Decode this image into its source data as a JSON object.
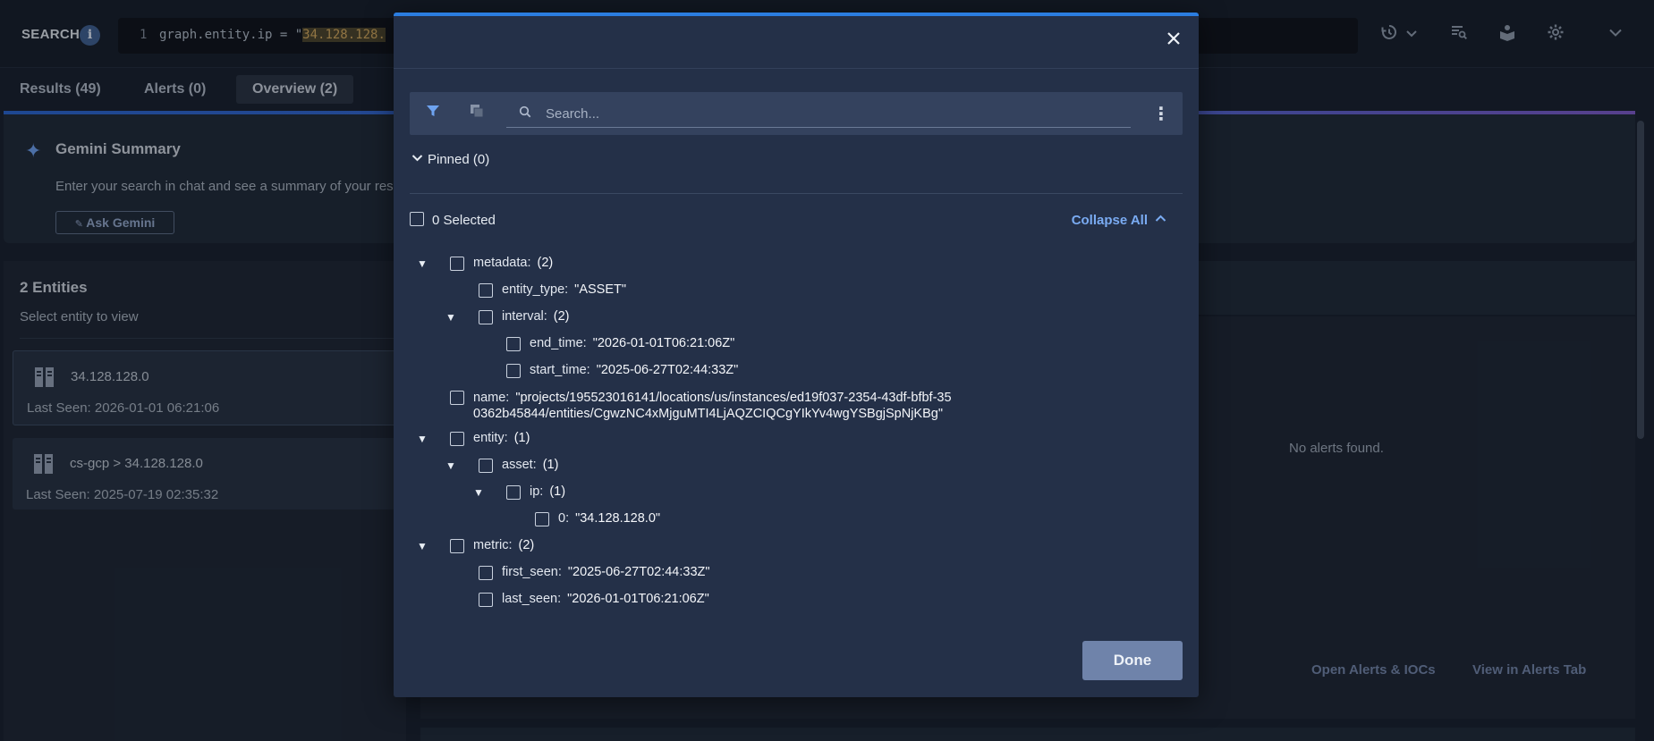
{
  "topbar": {
    "search_label": "SEARCH",
    "info_icon": "info-icon",
    "query_line_number": "1",
    "query_prefix": "graph.entity.ip = \"",
    "query_highlight": "34.128.128.",
    "icons": [
      "history-icon",
      "chevron-down-icon",
      "saved-search-icon",
      "book-icon",
      "gear-icon",
      "chevron-down-icon"
    ]
  },
  "tabs": [
    {
      "label": "Results (49)"
    },
    {
      "label": "Alerts (0)"
    },
    {
      "label": "Overview (2)",
      "active": true
    }
  ],
  "gemini": {
    "title": "Gemini Summary",
    "subtitle": "Enter your search in chat and see a summary of your result",
    "ask_button": "Ask Gemini"
  },
  "entities": {
    "title": "2 Entities",
    "subtitle": "Select entity to view",
    "items": [
      {
        "name": "34.128.128.0",
        "last_seen": "Last Seen: 2026-01-01 06:21:06",
        "selected": true
      },
      {
        "name": "cs-gcp > 34.128.128.0",
        "last_seen": "Last Seen: 2025-07-19 02:35:32"
      }
    ]
  },
  "right": {
    "no_alerts": "No alerts found.",
    "open_alerts_link": "Open Alerts & IOCs",
    "view_alerts_link": "View in Alerts Tab"
  },
  "modal": {
    "search_placeholder": "Search...",
    "pinned_label": "Pinned (0)",
    "selected_label": "0 Selected",
    "collapse_all": "Collapse All",
    "done_button": "Done",
    "tree": {
      "metadata": {
        "key": "metadata:",
        "count": "(2)"
      },
      "entity_type": {
        "key": "entity_type:",
        "value": "\"ASSET\""
      },
      "interval": {
        "key": "interval:",
        "count": "(2)"
      },
      "end_time": {
        "key": "end_time:",
        "value": "\"2026-01-01T06:21:06Z\""
      },
      "start_time": {
        "key": "start_time:",
        "value": "\"2025-06-27T02:44:33Z\""
      },
      "name": {
        "key": "name:",
        "value": "\"projects/195523016141/locations/us/instances/ed19f037-2354-43df-bfbf-350362b45844/entities/CgwzNC4xMjguMTI4LjAQZCIQCgYIkYv4wgYSBgjSpNjKBg\""
      },
      "entity": {
        "key": "entity:",
        "count": "(1)"
      },
      "asset": {
        "key": "asset:",
        "count": "(1)"
      },
      "ip": {
        "key": "ip:",
        "count": "(1)"
      },
      "ip0": {
        "key": "0:",
        "value": "\"34.128.128.0\""
      },
      "metric": {
        "key": "metric:",
        "count": "(2)"
      },
      "first_seen": {
        "key": "first_seen:",
        "value": "\"2025-06-27T02:44:33Z\""
      },
      "last_seen": {
        "key": "last_seen:",
        "value": "\"2026-01-01T06:21:06Z\""
      }
    }
  }
}
